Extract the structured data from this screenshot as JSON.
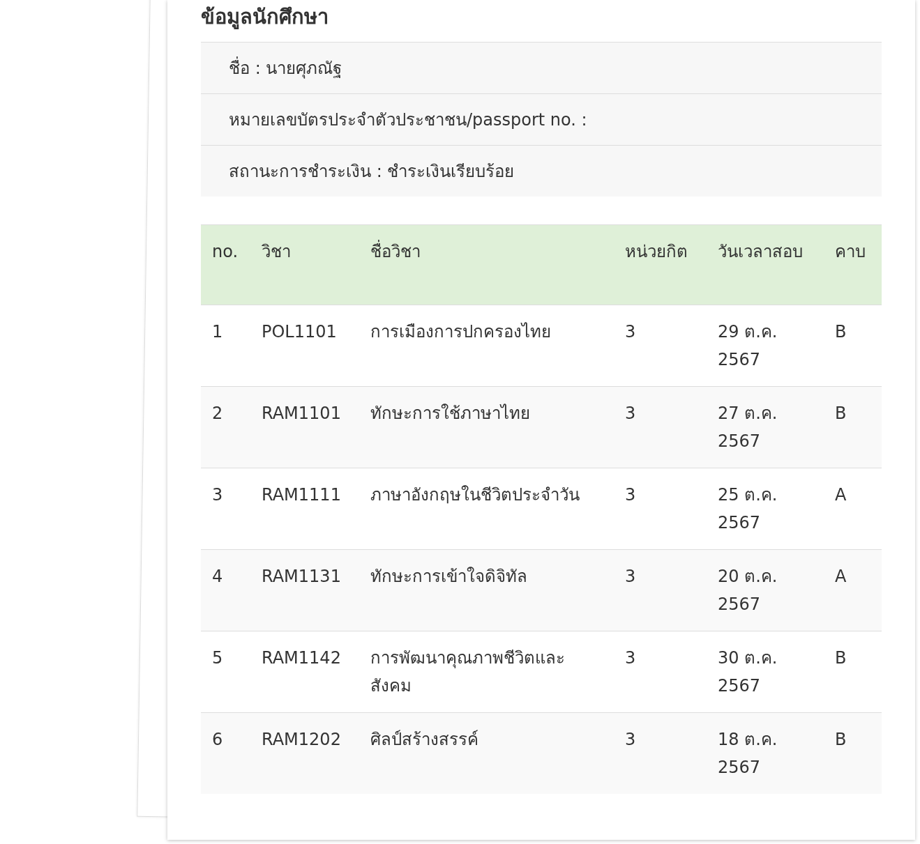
{
  "title": "ข้อมูลนักศึกษา",
  "info": [
    {
      "text": "ชื่อ : นายศุภณัฐ"
    },
    {
      "text": "หมายเลขบัตรประจำตัวประชาชน/passport no. :"
    },
    {
      "text": "สถานะการชำระเงิน : ชำระเงินเรียบร้อย"
    }
  ],
  "table": {
    "columns": [
      "no.",
      "วิชา",
      "ชื่อวิชา",
      "หน่วยกิต",
      "วันเวลาสอบ",
      "คาบ"
    ],
    "rows": [
      [
        "1",
        "POL1101",
        "การเมืองการปกครองไทย",
        "3",
        "29 ต.ค. 2567",
        "B"
      ],
      [
        "2",
        "RAM1101",
        "ทักษะการใช้ภาษาไทย",
        "3",
        "27 ต.ค. 2567",
        "B"
      ],
      [
        "3",
        "RAM1111",
        "ภาษาอังกฤษในชีวิตประจำวัน",
        "3",
        "25 ต.ค. 2567",
        "A"
      ],
      [
        "4",
        "RAM1131",
        "ทักษะการเข้าใจดิจิทัล",
        "3",
        "20 ต.ค. 2567",
        "A"
      ],
      [
        "5",
        "RAM1142",
        "การพัฒนาคุณภาพชีวิตและสังคม",
        "3",
        "30 ต.ค. 2567",
        "B"
      ],
      [
        "6",
        "RAM1202",
        "ศิลป์สร้างสรรค์",
        "3",
        "18 ต.ค. 2567",
        "B"
      ]
    ]
  }
}
